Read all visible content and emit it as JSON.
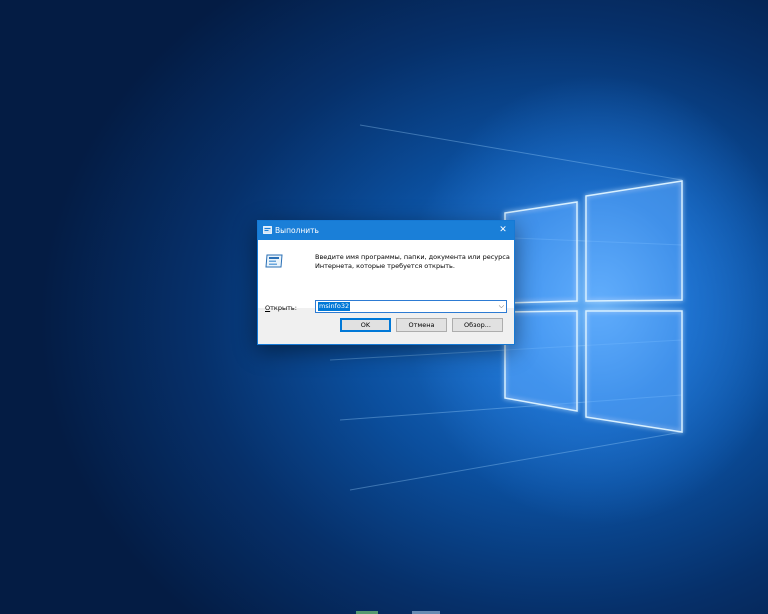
{
  "desktop": {
    "wallpaper": "windows-10-hero-logo",
    "colors": {
      "wallpaper_dark": "#041c44",
      "wallpaper_light": "#1f78d6",
      "dialog_title_bar": "#1a7fd8"
    }
  },
  "run_dialog": {
    "title": "Выполнить",
    "title_icon": "run-icon",
    "close_glyph": "✕",
    "description": "Введите имя программы, папки, документа или ресурса Интернета, которые требуется открыть.",
    "open_label_accel": "О",
    "open_label_rest": "ткрыть:",
    "command_value": "msinfo32",
    "dropdown_glyph": "⌵",
    "buttons": {
      "ok": "OK",
      "cancel": "Отмена",
      "browse": "Обзор..."
    }
  }
}
